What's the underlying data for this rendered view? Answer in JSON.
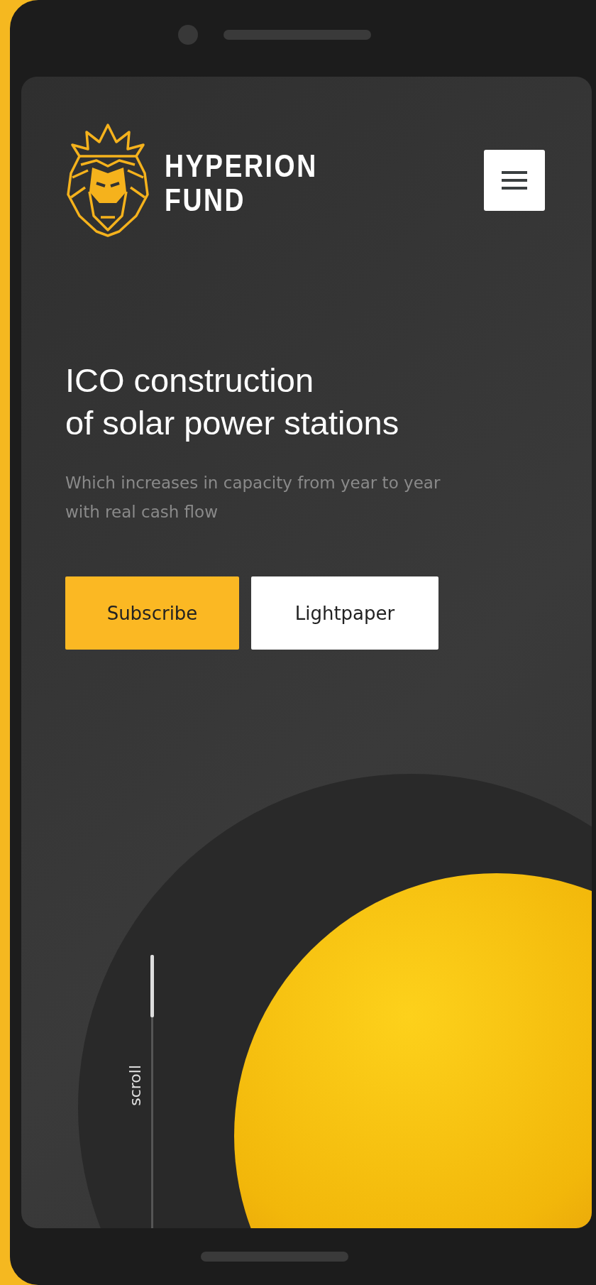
{
  "brand": {
    "line1": "HYPERION",
    "line2": "FUND"
  },
  "hero": {
    "title_lines": [
      "ICO construction",
      "of solar power stations"
    ],
    "subtitle": "Which increases in capacity from year to year with real cash flow"
  },
  "buttons": [
    {
      "label": "Subscribe",
      "kind": "primary"
    },
    {
      "label": "Lightpaper",
      "kind": "secondary"
    }
  ],
  "scroll": {
    "label": "scroll"
  }
}
